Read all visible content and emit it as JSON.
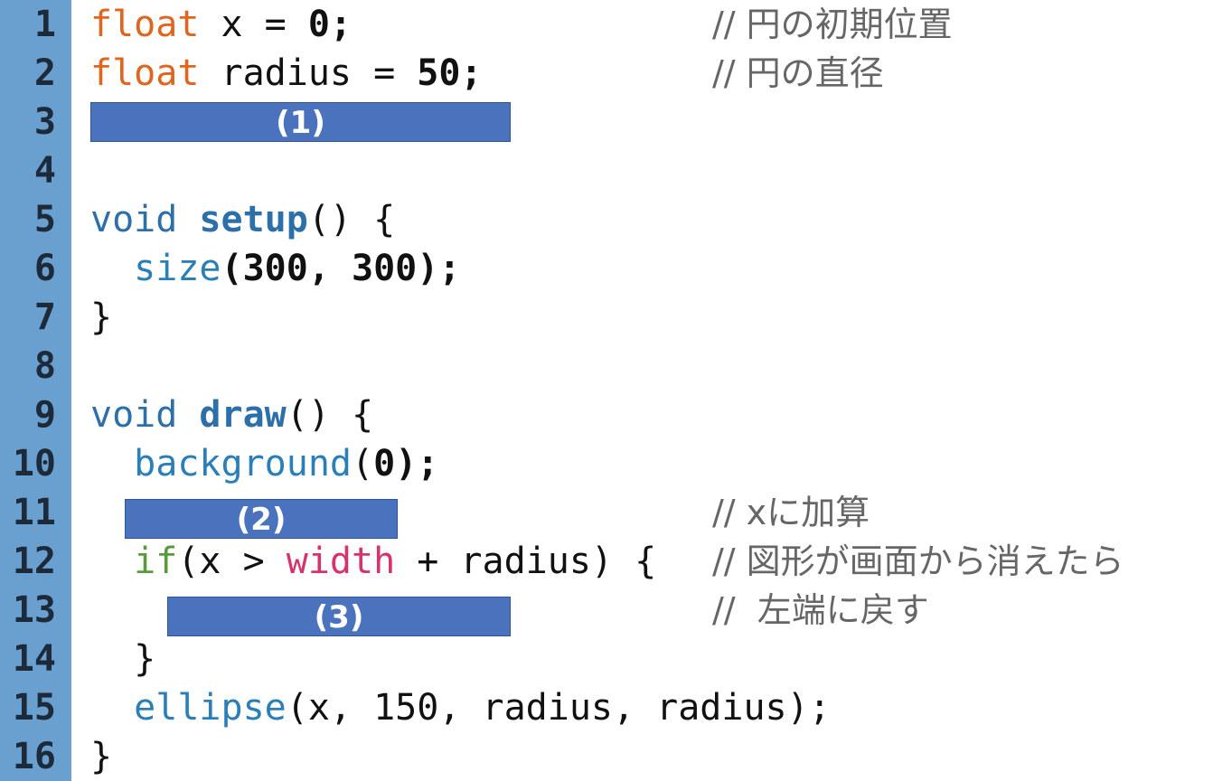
{
  "lines": [
    {
      "no": "1",
      "t1": "float",
      "t2": " x = ",
      "t3": "0",
      "t4": ";",
      "comment": "// 円の初期位置"
    },
    {
      "no": "2",
      "t1": "float",
      "t2": " radius = ",
      "t3": "50",
      "t4": ";",
      "comment": "// 円の直径"
    },
    {
      "no": "3",
      "blank": "(1)"
    },
    {
      "no": "4"
    },
    {
      "no": "5",
      "t1": "void",
      "t2": " ",
      "t3": "setup",
      "t4": "() {"
    },
    {
      "no": "6",
      "indent": "  ",
      "t1": "size",
      "t2": "(300, 300);"
    },
    {
      "no": "7",
      "t1": "}"
    },
    {
      "no": "8"
    },
    {
      "no": "9",
      "t1": "void",
      "t2": " ",
      "t3": "draw",
      "t4": "() {"
    },
    {
      "no": "10",
      "indent": "  ",
      "t1": "background",
      "t2": "(",
      "t3": "0",
      "t4": ");"
    },
    {
      "no": "11",
      "blank": "(2)",
      "comment": "// xに加算"
    },
    {
      "no": "12",
      "indent": "  ",
      "t1": "if",
      "t2": "(x > ",
      "t3": "width",
      "t4": " + radius) { ",
      "comment": "// 図形が画面から消えたら"
    },
    {
      "no": "13",
      "blank": "(3)",
      "comment": "//  左端に戻す"
    },
    {
      "no": "14",
      "indent": "  ",
      "t1": "}"
    },
    {
      "no": "15",
      "indent": "  ",
      "t1": "ellipse",
      "t2": "(x, 150, radius, radius);"
    },
    {
      "no": "16",
      "t1": "}"
    }
  ]
}
